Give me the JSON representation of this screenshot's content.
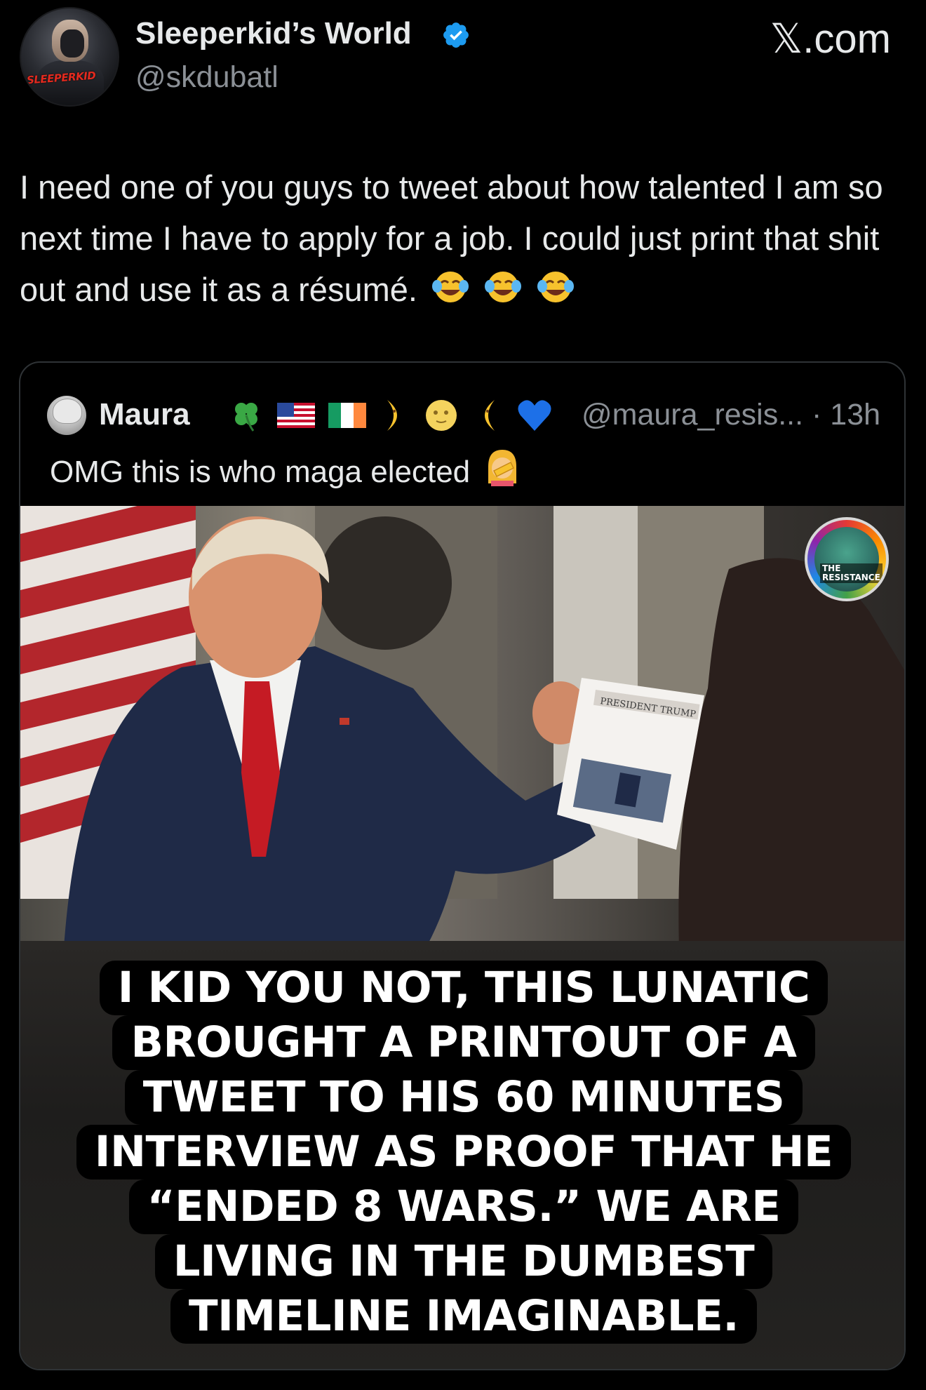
{
  "tweet": {
    "author": {
      "display_name": "Sleeperkid’s World",
      "handle": "@skdubatl",
      "verified": true,
      "avatar_text": "SLEEPERKID"
    },
    "site_label": "𝕏.com",
    "text": "I need one of you guys to tweet about how talented I am so next time I have to apply for a job. I could just print that shit out and use it as a résumé.",
    "emojis": [
      "face-with-tears-of-joy",
      "face-with-tears-of-joy",
      "face-with-tears-of-joy"
    ]
  },
  "quoted_tweet": {
    "author": {
      "display_name": "Maura",
      "name_emojis": [
        "four-leaf-clover",
        "us-flag",
        "ireland-flag",
        "first-quarter-moon-face",
        "full-moon-face",
        "last-quarter-moon-face",
        "blue-heart"
      ],
      "handle": "@maura_resis...",
      "time": "· 13h"
    },
    "text": "OMG this is who maga elected",
    "text_emoji": "woman-facepalming",
    "media": {
      "logo_text": "THE\nRESISTANCE",
      "caption_lines": [
        "I KID YOU NOT, THIS LUNATIC",
        "BROUGHT A PRINTOUT OF A",
        "TWEET TO HIS 60 MINUTES",
        "INTERVIEW AS PROOF THAT HE",
        "“ENDED 8 WARS.” WE ARE",
        "LIVING IN THE DUMBEST",
        "TIMELINE IMAGINABLE."
      ],
      "paper_text": "PRESIDENT TRUMP"
    }
  },
  "colors": {
    "background": "#000000",
    "text": "#e7e9ea",
    "secondary_text": "#8b9096",
    "border": "#2f3336",
    "verified_blue": "#1d9bf0"
  }
}
